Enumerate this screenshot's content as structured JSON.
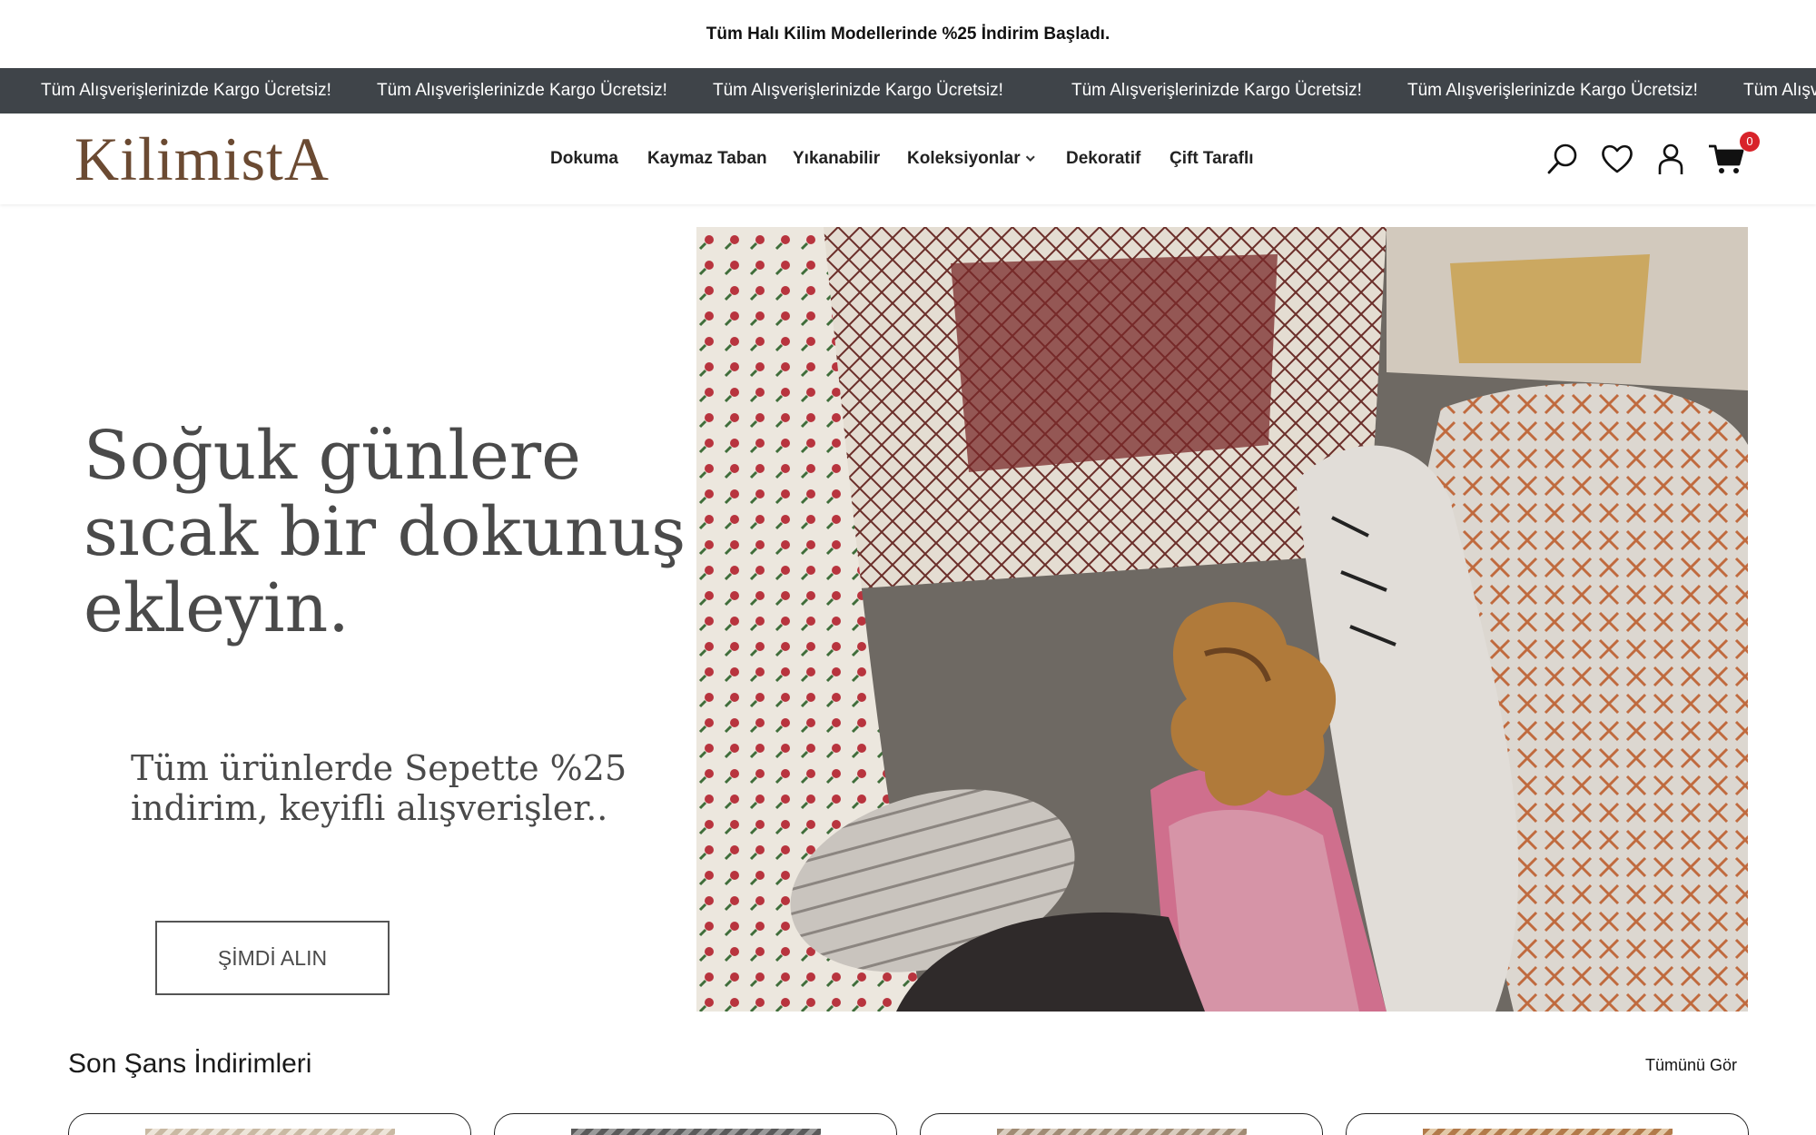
{
  "announcement": {
    "text": "Tüm Halı Kilim Modellerinde %25 İndirim Başladı."
  },
  "marquee": {
    "items": [
      "Tüm Alışverişlerinizde Kargo Ücretsiz!",
      "Tüm Alışverişlerinizde Kargo Ücretsiz!",
      "Tüm Alışverişlerinizde Kargo Ücretsiz!",
      "Tüm Alışverişlerinizde Kargo Ücretsiz!",
      "Tüm Alışverişlerinizde Kargo Ücretsiz!",
      "Tüm Alışv"
    ]
  },
  "header": {
    "logo": "KilimistA",
    "nav": [
      {
        "label": "Dokuma"
      },
      {
        "label": "Kaymaz Taban"
      },
      {
        "label": "Yıkanabilir"
      },
      {
        "label": "Koleksiyonlar"
      },
      {
        "label": "Dekoratif"
      },
      {
        "label": "Çift Taraflı"
      }
    ],
    "icons": [
      "search-icon",
      "heart-icon",
      "user-icon",
      "cart-icon"
    ],
    "cart_count": "0",
    "badge_color": "#d8232a"
  },
  "hero": {
    "title": "Soğuk günlere sıcak bir dokunuş ekleyin.",
    "subtitle": "Tüm ürünlerde Sepette %25 indirim, keyifli alışverişler..",
    "button": "ŞİMDİ ALIN"
  },
  "section": {
    "title": "Son Şans İndirimleri",
    "see_all": "Tümünü Gör"
  },
  "colors": {
    "marquee_bg": "#3f4449",
    "logo": "#6b4a32",
    "hero_text": "#4a4a4a"
  }
}
